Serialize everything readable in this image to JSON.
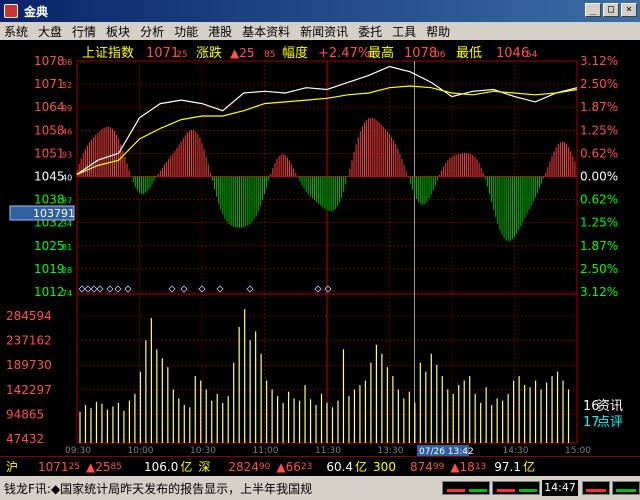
{
  "window": {
    "title": "金典",
    "minimize_label": "_",
    "maximize_label": "□",
    "close_label": "×"
  },
  "menu": [
    "系统",
    "大盘",
    "行情",
    "板块",
    "分析",
    "功能",
    "港股",
    "基本资料",
    "新闻资讯",
    "委托",
    "工具",
    "帮助"
  ],
  "header": {
    "name": "上证指数",
    "price": "1071",
    "price_small": "25",
    "chg_label": "涨跌",
    "chg": "▲25",
    "chg_small": "85",
    "pct_label": "幅度",
    "pct": "+2.47%",
    "high_label": "最高",
    "high": "1078",
    "high_small": "06",
    "low_label": "最低",
    "low": "1046",
    "low_small": "54"
  },
  "colors": {
    "up": "#ff4040",
    "down": "#00c000",
    "grid": "#a00000",
    "price_line": "#ffffff",
    "avg_line": "#ffff00",
    "volume": "#ffff80"
  },
  "price_axis_left": [
    {
      "big": "1078",
      "small": "06",
      "cls": "red"
    },
    {
      "big": "1071",
      "small": "52",
      "cls": "red"
    },
    {
      "big": "1064",
      "small": "99",
      "cls": "red"
    },
    {
      "big": "1058",
      "small": "46",
      "cls": "red"
    },
    {
      "big": "1051",
      "small": "93",
      "cls": "red"
    },
    {
      "big": "1045",
      "small": "40",
      "cls": "white"
    },
    {
      "big": "1038",
      "small": "87",
      "cls": "green"
    },
    {
      "big": "1032",
      "small": "34",
      "cls": "green"
    },
    {
      "big": "1025",
      "small": "81",
      "cls": "green"
    },
    {
      "big": "1019",
      "small": "28",
      "cls": "green"
    },
    {
      "big": "1012",
      "small": "74",
      "cls": "green"
    }
  ],
  "price_axis_right": [
    "3.12%",
    "2.50%",
    "1.87%",
    "1.25%",
    "0.62%",
    "0.00%",
    "0.62%",
    "1.25%",
    "1.87%",
    "2.50%",
    "3.12%"
  ],
  "cursor_label": "103791",
  "volume_axis": [
    "284594",
    "237162",
    "189730",
    "142297",
    "94865",
    "47432"
  ],
  "time_axis": [
    "09:30",
    "10:00",
    "10:30",
    "11:00",
    "11:30",
    "13:30",
    "14:00",
    "14:30",
    "15:00"
  ],
  "cursor_time": "07/26 13:42",
  "side_info": {
    "news_count": "16",
    "news_label": "资讯",
    "comment_count": "17",
    "comment_label": "点评"
  },
  "status_row": {
    "sh_label": "沪",
    "sh_price": "1071",
    "sh_price_small": "25",
    "sh_chg": "▲25",
    "sh_chg_small": "85",
    "sh_amount": "106.0",
    "sh_unit": "亿",
    "sz_label": "深",
    "sz_price": "2824",
    "sz_price_small": "90",
    "sz_chg": "▲66",
    "sz_chg_small": "23",
    "sz_amount": "60.4",
    "sz_unit": "亿",
    "i300_label": "300",
    "i300_price": "874",
    "i300_price_small": "99",
    "i300_chg": "▲18",
    "i300_chg_small": "13",
    "i300_amount": "97.1",
    "i300_unit": "亿"
  },
  "ticker": {
    "source": "钱龙F讯:",
    "text": "◆国家统计局昨天发布的报告显示，上半年我国规"
  },
  "clock": "14:47",
  "chart_data": {
    "type": "line",
    "title": "上证指数",
    "x_range": [
      "09:30",
      "15:00"
    ],
    "ylim": [
      1012.74,
      1078.06
    ],
    "prev_close": 1045.4,
    "series": [
      {
        "x": [
          "09:30",
          "09:40",
          "09:50",
          "10:00",
          "10:10",
          "10:20",
          "10:30",
          "10:40",
          "10:50",
          "11:00",
          "11:10",
          "11:20",
          "11:30",
          "13:10",
          "13:20",
          "13:30",
          "13:40",
          "13:50",
          "14:00",
          "14:10",
          "14:20",
          "14:30",
          "14:40",
          "14:50",
          "15:00"
        ],
        "values": [
          1046.0,
          1050.0,
          1052.0,
          1062.0,
          1066.0,
          1067.0,
          1066.0,
          1064.0,
          1069.0,
          1069.5,
          1069.0,
          1070.5,
          1070.0,
          1072.0,
          1074.0,
          1076.5,
          1075.0,
          1072.0,
          1068.0,
          1069.5,
          1070.0,
          1068.0,
          1066.5,
          1069.0,
          1070.5
        ]
      },
      {
        "x": [
          "09:30",
          "09:40",
          "09:50",
          "10:00",
          "10:10",
          "10:20",
          "10:30",
          "10:40",
          "10:50",
          "11:00",
          "11:10",
          "11:20",
          "11:30",
          "13:10",
          "13:20",
          "13:30",
          "13:40",
          "13:50",
          "14:00",
          "14:10",
          "14:20",
          "14:30",
          "14:40",
          "14:50",
          "15:00"
        ],
        "values": [
          1046.0,
          1048.5,
          1050.0,
          1056.0,
          1059.0,
          1061.5,
          1062.5,
          1062.5,
          1064.0,
          1066.0,
          1066.5,
          1067.0,
          1067.5,
          1068.5,
          1069.0,
          1070.5,
          1071.0,
          1070.5,
          1069.0,
          1068.5,
          1069.5,
          1069.0,
          1068.5,
          1069.0,
          1070.0
        ]
      }
    ],
    "volume": {
      "ylim": [
        0,
        284594
      ],
      "values": [
        70000,
        85000,
        78000,
        92000,
        88000,
        75000,
        82000,
        90000,
        72000,
        95000,
        110000,
        160000,
        230000,
        280000,
        210000,
        190000,
        170000,
        120000,
        100000,
        85000,
        80000,
        150000,
        140000,
        120000,
        95000,
        110000,
        90000,
        105000,
        180000,
        260000,
        300000,
        230000,
        250000,
        200000,
        140000,
        120000,
        105000,
        90000,
        115000,
        100000,
        95000,
        130000,
        98000,
        85000,
        110000,
        90000,
        80000,
        95000,
        210000,
        105000,
        120000,
        130000,
        140000,
        180000,
        220000,
        200000,
        170000,
        150000,
        120000,
        100000,
        115000,
        90000,
        180000,
        160000,
        200000,
        175000,
        150000,
        120000,
        110000,
        130000,
        140000,
        150000,
        110000,
        90000,
        125000,
        85000,
        100000,
        95000,
        110000,
        140000,
        150000,
        130000,
        125000,
        140000,
        120000,
        135000,
        150000,
        160000,
        140000,
        120000
      ]
    }
  }
}
